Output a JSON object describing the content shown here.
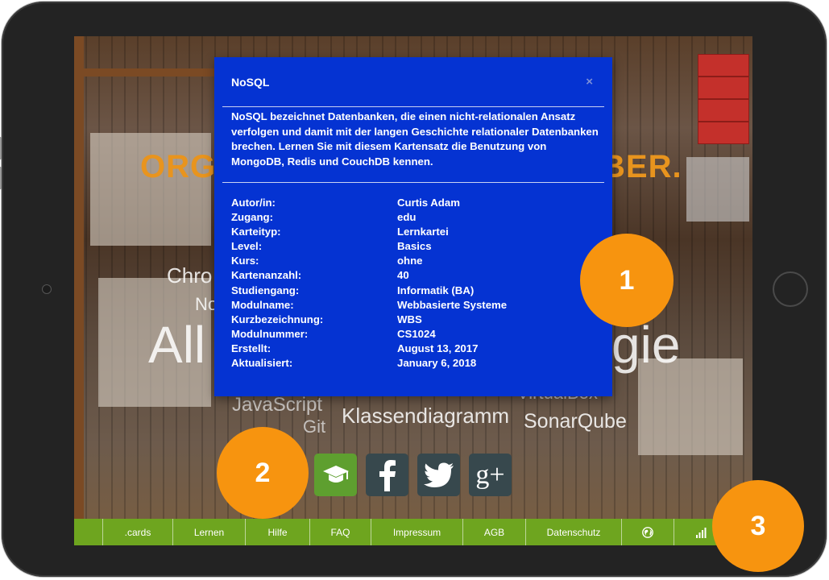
{
  "background": {
    "headline_left": "ORG",
    "headline_right": "BER.",
    "word_cloud": [
      {
        "text": "Chro",
        "size": 26
      },
      {
        "text": "No",
        "size": 22
      },
      {
        "text": "All",
        "size": 62
      },
      {
        "text": "gie",
        "size": 62
      },
      {
        "text": "JavaScript",
        "size": 24
      },
      {
        "text": "Git",
        "size": 22
      },
      {
        "text": "Klassendiagramm",
        "size": 26
      },
      {
        "text": "VirtualBox",
        "size": 22
      },
      {
        "text": "SonarQube",
        "size": 24
      }
    ]
  },
  "modal": {
    "title": "NoSQL",
    "close_label": "×",
    "description": "NoSQL bezeichnet Datenbanken, die einen nicht-relationalen Ansatz verfolgen und damit mit der langen Geschichte relationaler Datenbanken brechen. Lernen Sie mit diesem Kartensatz die Benutzung von MongoDB, Redis und CouchDB kennen.",
    "fields": [
      {
        "key": "Autor/in:",
        "value": "Curtis Adam"
      },
      {
        "key": "Zugang:",
        "value": "edu"
      },
      {
        "key": "Karteityp:",
        "value": "Lernkartei"
      },
      {
        "key": "Level:",
        "value": "Basics"
      },
      {
        "key": "Kurs:",
        "value": "ohne"
      },
      {
        "key": "Kartenanzahl:",
        "value": "40"
      },
      {
        "key": "Studiengang:",
        "value": "Informatik (BA)"
      },
      {
        "key": "Modulname:",
        "value": "Webbasierte Systeme"
      },
      {
        "key": "Kurzbezeichnung:",
        "value": "WBS"
      },
      {
        "key": "Modulnummer:",
        "value": "CS1024"
      },
      {
        "key": "Erstellt:",
        "value": "August 13, 2017"
      },
      {
        "key": "Aktualisiert:",
        "value": "January 6, 2018"
      }
    ]
  },
  "social": [
    {
      "name": "graduation-cap-icon",
      "color": "#5e9f2f"
    },
    {
      "name": "facebook-icon",
      "color": "#37484d"
    },
    {
      "name": "twitter-icon",
      "color": "#37484d"
    },
    {
      "name": "google-plus-icon",
      "color": "#37484d"
    }
  ],
  "footer": {
    "items": [
      ".cards",
      "Lernen",
      "Hilfe",
      "FAQ",
      "Impressum",
      "AGB",
      "Datenschutz"
    ],
    "icons": [
      "globe-icon",
      "signal-icon"
    ],
    "color": "#6ea51f"
  },
  "badges": [
    "1",
    "2",
    "3"
  ],
  "accent": "#f7940f"
}
